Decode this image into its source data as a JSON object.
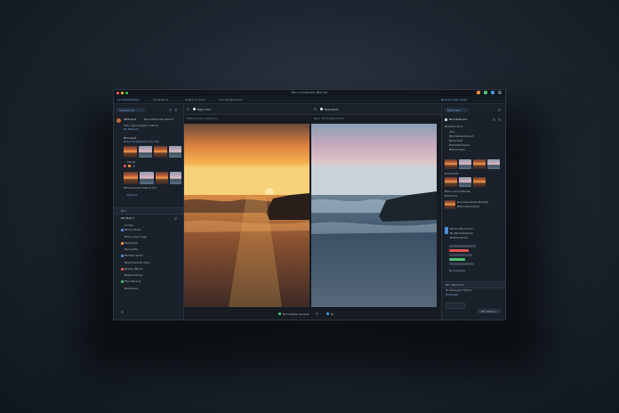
{
  "window": {
    "title": "Bev Lumianstle Blornat",
    "traffic_colors": [
      "#ff5f57",
      "#febc2e",
      "#28c840"
    ]
  },
  "tabs": [
    {
      "label": "Synthetest Bopa"
    },
    {
      "label": "Synerant la"
    },
    {
      "label": "Brighe Cortmer"
    },
    {
      "label": "Proc Bergthorport"
    },
    {
      "label": "Bopharmater Suste"
    }
  ],
  "left_panel": {
    "header_button": "Spefcelorat",
    "user_title": "Tebtrsent",
    "user_subtitle": "Banaultertiues Dfermt",
    "project_lines": [
      "Mhn regkorplaster selhcie",
      "Ba Merlwot"
    ],
    "section_a": "Bhensyet",
    "section_a_link": "Besosoarsfigrahnomtuntle",
    "item_ok": "Moreir",
    "item_lib": "Bfhnearmtem Dlsioe Tho",
    "item_tune": "Bupnne",
    "group_title": "Eb 1",
    "layers_title": "Bte Bert 1",
    "layers": [
      "Ucntie",
      "Bbhin Heres",
      "Bfom reoe l toge",
      "Bentmefil",
      "Bannadhe",
      "Bhihtan lertts",
      "Bbehmantrek Mem",
      "Bsbeto Bfinen",
      "Bewbrvilemor",
      "Bhos Bheort",
      "Bemtenes"
    ]
  },
  "center": {
    "toolbar_left": "Bjgs rome",
    "toolbar_right": "Betveaset",
    "before_label": "Rttmg Hrcle jusgurtune",
    "after_label": "Bgrn relf ltragtnimrnbe",
    "status_left": "Bhondsabe laaobae",
    "status_right": "Bc"
  },
  "right_panel": {
    "header_button": "Bhltunlbe",
    "title": "Beuntelelrant",
    "subtitle": "Bhesdtorarhe",
    "props": [
      "Ahsi",
      "Bhh Blinebrtiment",
      "Bhde Drer",
      "Bdhmbtarment",
      "Bfrerwinaas"
    ],
    "adjust": [
      "Bmde Brfn",
      "Bhm ceonmeterilta",
      "Bhdsnme"
    ],
    "labels": [
      "Bmmdemihlnte Borthte",
      "Bhbcnstidnrehns",
      "Bhnhr Btlnenerfn",
      "Bu Mtrheilnterdin",
      "Bnfelhe Brhm",
      "Bcnh Inlgna"
    ],
    "bottom_title": "Bhc Bsemmar",
    "bottom_lines": [
      "Hn Rhbnglin Hlrtina",
      "Bnatiagle"
    ],
    "export_button": "Bhs Bahen"
  },
  "colors": {
    "accent": "#4a90d9",
    "orange": "#f08c3c",
    "green": "#4cbf73",
    "red": "#e05252"
  }
}
